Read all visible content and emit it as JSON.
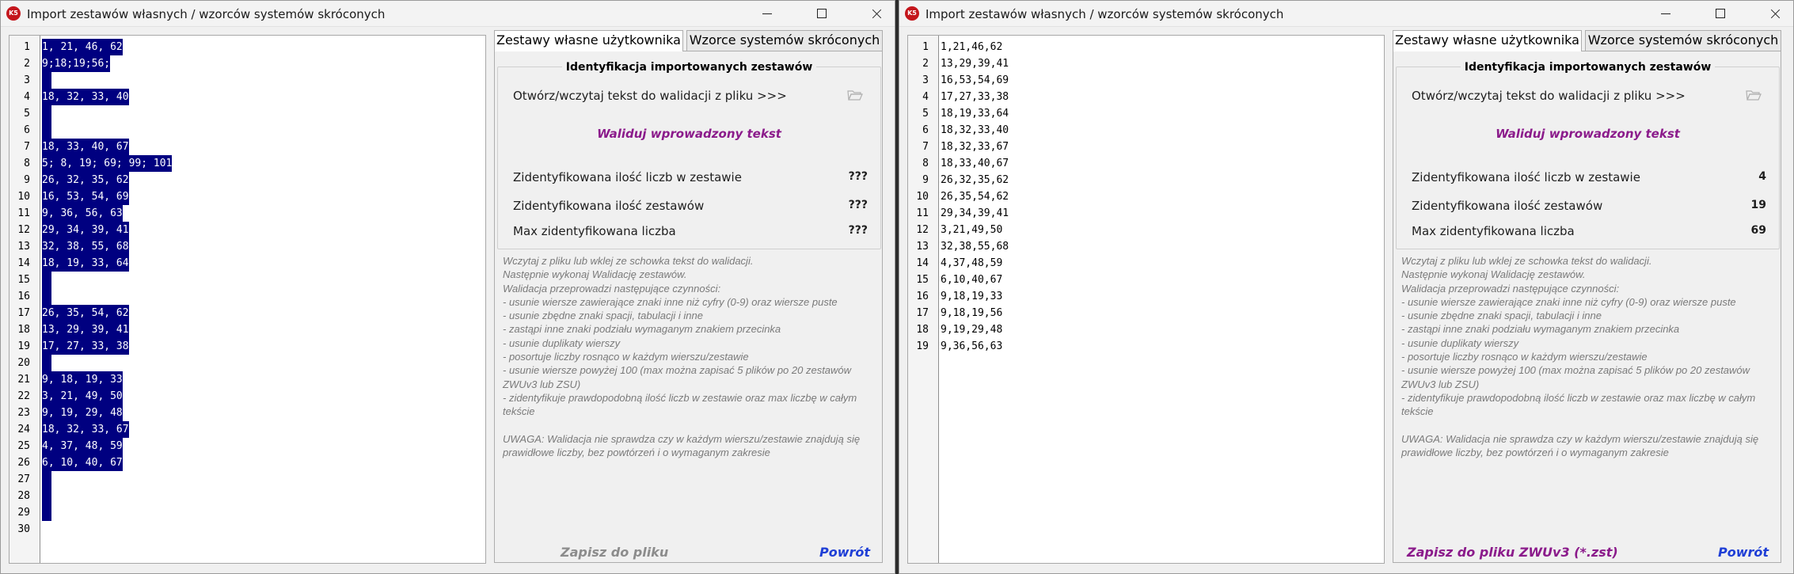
{
  "colors": {
    "selection": "#000080",
    "accent_purple": "#8b1b8b",
    "link_blue": "#1f3fd6"
  },
  "window_title": "Import zestawów własnych / wzorców systemów skróconych",
  "app_icon_text": "K5",
  "tabs": [
    "Zestawy własne użytkownika",
    "Wzorce systemów skróconych"
  ],
  "group_title": "Identyfikacja importowanych zestawów",
  "open_file_label": "Otwórz/wczytaj tekst do walidacji z pliku >>>",
  "validate_label": "Waliduj wprowadzony tekst",
  "stat_labels": [
    "Zidentyfikowana ilość liczb w zestawie",
    "Zidentyfikowana ilość zestawów",
    "Max zidentyfikowana liczba"
  ],
  "notes": [
    "Wczytaj z pliku lub wklej ze schowka tekst do walidacji.",
    "Następnie wykonaj Walidację zestawów.",
    "Walidacja przeprowadzi następujące czynności:",
    "- usunie wiersze zawierające znaki inne niż cyfry (0-9) oraz wiersze puste",
    "- usunie zbędne znaki spacji, tabulacji i inne",
    "- zastąpi inne znaki podziału wymaganym znakiem przecinka",
    "- usunie duplikaty wierszy",
    "- posortuje liczby rosnąco w każdym wierszu/zestawie",
    "- usunie wiersze powyżej 100 (max można zapisać 5 plików po 20 zestawów ZWUv3 lub ZSU)",
    "- zidentyfikuje prawdopodobną ilość liczb w zestawie oraz max liczbę w całym tekście"
  ],
  "warning": "UWAGA: Walidacja nie sprawdza czy w każdym wierszu/zestawie znajdują się prawidłowe liczby, bez powtórzeń i o wymaganym zakresie",
  "back_label": "Powrót",
  "left": {
    "lines": [
      "1, 21, 46, 62",
      "9;18;19;56;",
      "",
      "18, 32, 33, 40",
      "",
      "",
      "18, 33, 40, 67",
      "5; 8, 19; 69; 99; 101",
      "26, 32, 35, 62",
      "16, 53, 54, 69",
      "9, 36, 56, 63",
      "29, 34, 39, 41",
      "32, 38, 55, 68",
      "18, 19, 33, 64",
      "",
      "",
      "26, 35, 54, 62",
      "13, 29, 39, 41",
      "17, 27, 33, 38",
      "",
      "9, 18, 19, 33",
      "3, 21, 49, 50",
      "9, 19, 29, 48",
      "18, 32, 33, 67",
      "4, 37, 48, 59",
      "6, 10, 40, 67",
      "",
      "",
      "",
      ""
    ],
    "selected_line_count": 29,
    "stats": [
      "???",
      "???",
      "???"
    ],
    "save_label": "Zapisz do pliku"
  },
  "right": {
    "lines": [
      "1,21,46,62",
      "13,29,39,41",
      "16,53,54,69",
      "17,27,33,38",
      "18,19,33,64",
      "18,32,33,40",
      "18,32,33,67",
      "18,33,40,67",
      "26,32,35,62",
      "26,35,54,62",
      "29,34,39,41",
      "3,21,49,50",
      "32,38,55,68",
      "4,37,48,59",
      "6,10,40,67",
      "9,18,19,33",
      "9,18,19,56",
      "9,19,29,48",
      "9,36,56,63"
    ],
    "stats": [
      "4",
      "19",
      "69"
    ],
    "save_label": "Zapisz do pliku ZWUv3 (*.zst)"
  }
}
